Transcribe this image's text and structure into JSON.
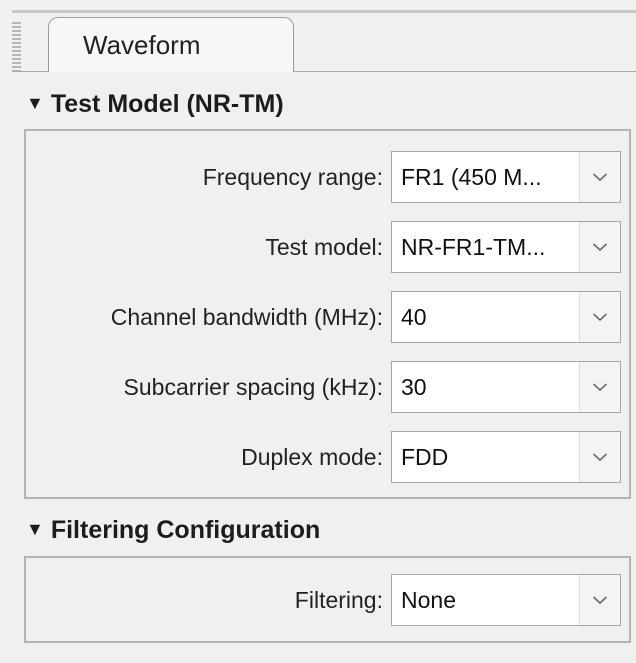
{
  "tabs": [
    {
      "label": "Waveform",
      "active": true
    }
  ],
  "sections": {
    "test_model": {
      "title": "Test Model (NR-TM)",
      "fields": [
        {
          "label": "Frequency range:",
          "value": "FR1 (450 M..."
        },
        {
          "label": "Test model:",
          "value": "NR-FR1-TM..."
        },
        {
          "label": "Channel bandwidth (MHz):",
          "value": "40"
        },
        {
          "label": "Subcarrier spacing (kHz):",
          "value": "30"
        },
        {
          "label": "Duplex mode:",
          "value": "FDD"
        }
      ]
    },
    "filtering": {
      "title": "Filtering Configuration",
      "fields": [
        {
          "label": "Filtering:",
          "value": "None"
        }
      ]
    }
  },
  "icons": {
    "collapse": "triangle-down-icon",
    "dropdown": "chevron-down-icon"
  },
  "colors": {
    "background": "#f0f0f0",
    "panel_border": "#b4b4b4",
    "field_background": "#ffffff"
  }
}
